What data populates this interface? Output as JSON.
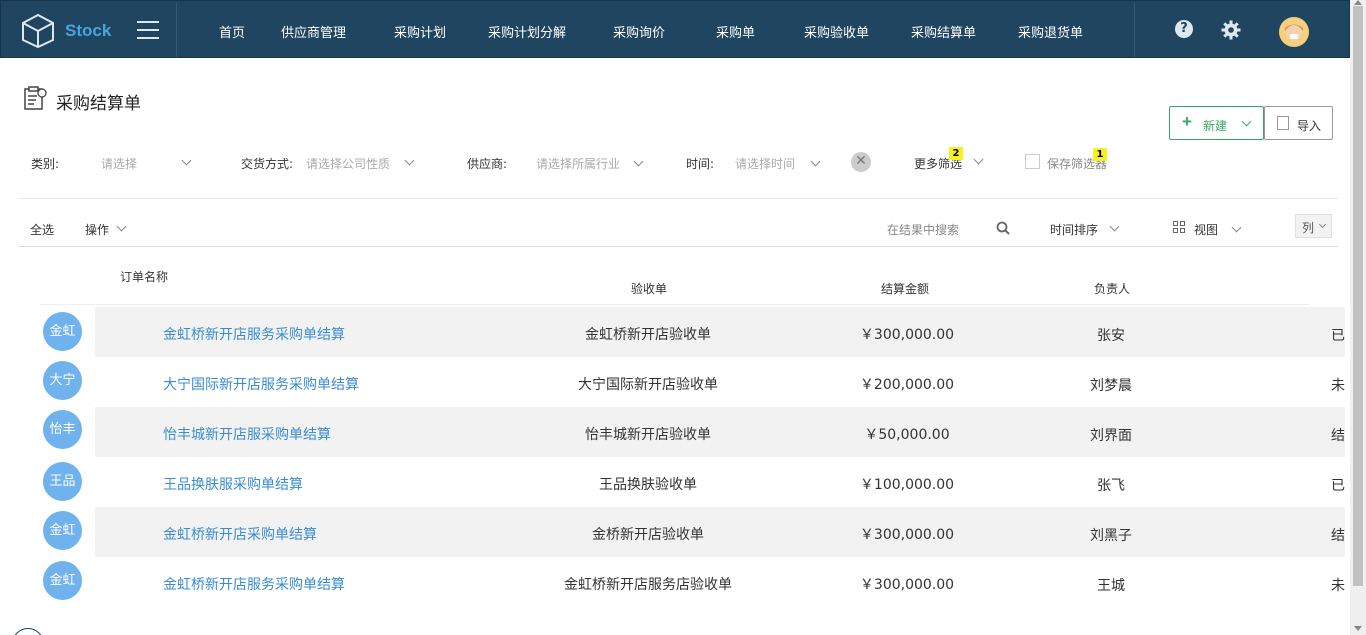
{
  "app": {
    "name": "Stock"
  },
  "nav": {
    "items": [
      {
        "label": "首页"
      },
      {
        "label": "供应商管理"
      },
      {
        "label": "采购计划"
      },
      {
        "label": "采购计划分解"
      },
      {
        "label": "采购询价"
      },
      {
        "label": "采购单"
      },
      {
        "label": "采购验收单"
      },
      {
        "label": "采购结算单"
      },
      {
        "label": "采购退货单"
      }
    ],
    "help_glyph": "?"
  },
  "page": {
    "title": "采购结算单"
  },
  "actions": {
    "new_label": "新建",
    "import_label": "导入"
  },
  "filters": {
    "category_label": "类别:",
    "category_placeholder": "请选择",
    "delivery_label": "交货方式:",
    "delivery_placeholder": "请选择公司性质",
    "supplier_label": "供应商:",
    "supplier_placeholder": "请选择所属行业",
    "time_label": "时间:",
    "time_placeholder": "请选择时间",
    "clear_glyph": "✕",
    "more_label": "更多筛选",
    "more_badge": "2",
    "save_label": "保存筛选器",
    "save_badge": "1"
  },
  "toolbar": {
    "select_all": "全选",
    "operation": "操作",
    "search_placeholder": "在结果中搜索",
    "sort": "时间排序",
    "view": "视图",
    "columns": "列"
  },
  "table": {
    "headers": {
      "name": "订单名称",
      "acceptance": "验收单",
      "amount": "结算金额",
      "owner": "负责人"
    },
    "rows": [
      {
        "avatar": "金虹",
        "name": "金虹桥新开店服务采购单结算",
        "acceptance": "金虹桥新开店验收单",
        "amount": "￥300,000.00",
        "owner": "张安",
        "status": "已"
      },
      {
        "avatar": "大宁",
        "name": "大宁国际新开店服务采购单结算",
        "acceptance": "大宁国际新开店验收单",
        "amount": "￥200,000.00",
        "owner": "刘梦晨",
        "status": "未"
      },
      {
        "avatar": "怡丰",
        "name": "怡丰城新开店服采购单结算",
        "acceptance": "怡丰城新开店验收单",
        "amount": "￥50,000.00",
        "owner": "刘界面",
        "status": "结"
      },
      {
        "avatar": "王品",
        "name": "王品换肤服采购单结算",
        "acceptance": "王品换肤验收单",
        "amount": "￥100,000.00",
        "owner": "张飞",
        "status": "已"
      },
      {
        "avatar": "金虹",
        "name": "金虹桥新开店采购单结算",
        "acceptance": "金桥新开店验收单",
        "amount": "￥300,000.00",
        "owner": "刘黑子",
        "status": "结"
      },
      {
        "avatar": "金虹",
        "name": "金虹桥新开店服务采购单结算",
        "acceptance": "金虹桥新开店服务店验收单",
        "amount": "￥300,000.00",
        "owner": "王城",
        "status": "未"
      }
    ]
  },
  "colors": {
    "topbar": "#1f4560",
    "accent_blue": "#3a8ccf",
    "accent_green": "#3aa66a",
    "badge_yellow": "#f8f120",
    "avatar_blue": "#6fb2ee"
  }
}
